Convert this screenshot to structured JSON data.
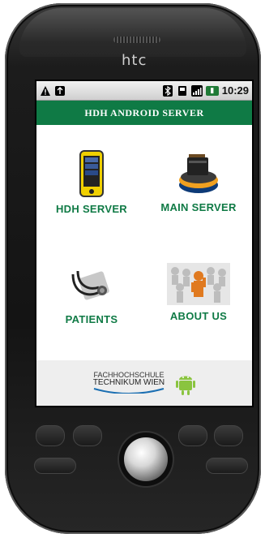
{
  "phone": {
    "brand": "htc"
  },
  "status_bar": {
    "left_icons": [
      "warning-icon",
      "usb-icon"
    ],
    "right_icons": [
      "bluetooth-icon",
      "sd-card-icon",
      "signal-icon",
      "battery-icon"
    ],
    "time": "10:29"
  },
  "app": {
    "title": "HDH ANDROID SERVER",
    "accent": "#0f7a45"
  },
  "menu": {
    "items": [
      {
        "label": "HDH SERVER",
        "icon": "phone-device-icon"
      },
      {
        "label": "MAIN SERVER",
        "icon": "server-icon"
      },
      {
        "label": "PATIENTS",
        "icon": "stethoscope-icon"
      },
      {
        "label": "ABOUT US",
        "icon": "people-icon"
      }
    ]
  },
  "footer": {
    "logo_line1": "FACHHOCHSCHULE",
    "logo_line2": "TECHNIKUM WIEN",
    "mascot": "android-mascot-icon"
  }
}
